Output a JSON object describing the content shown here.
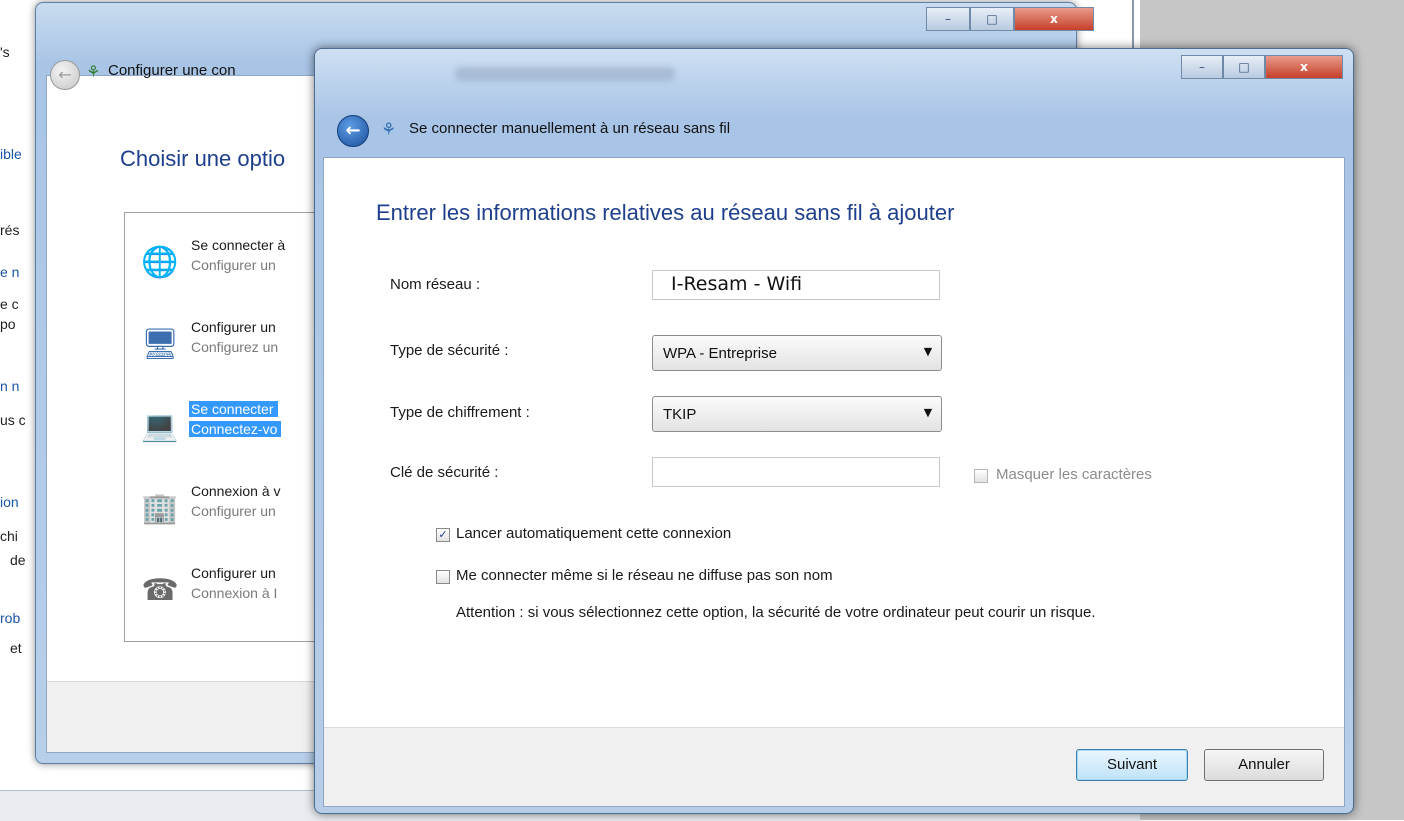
{
  "background": {
    "left_fragments": [
      {
        "text": "'s",
        "link": false
      },
      {
        "text": "ible",
        "link": true
      },
      {
        "text": "rés",
        "link": false
      },
      {
        "text": "e n",
        "link": true
      },
      {
        "text": "e c",
        "link": false
      },
      {
        "text": "po",
        "link": false
      },
      {
        "text": "n n",
        "link": true
      },
      {
        "text": "us c",
        "link": false
      },
      {
        "text": "ion",
        "link": true
      },
      {
        "text": "chi",
        "link": false
      },
      {
        "text": "de",
        "link": false
      },
      {
        "text": "rob",
        "link": true
      },
      {
        "text": "et",
        "link": false
      }
    ]
  },
  "back_window": {
    "title": "Configurer une con",
    "heading": "Choisir une optio",
    "controls": [
      "–",
      "□",
      "x"
    ],
    "options": [
      {
        "title": "Se connecter à",
        "subtitle": "Configurer un",
        "icon": "globe-network-icon",
        "selected": false
      },
      {
        "title": "Configurer un",
        "subtitle": "Configurez un",
        "icon": "router-network-icon",
        "selected": false
      },
      {
        "title": "Se connecter",
        "subtitle": "Connectez-vo",
        "icon": "computer-wireless-icon",
        "selected": true
      },
      {
        "title": "Connexion à v",
        "subtitle": "Configurer un",
        "icon": "vpn-building-icon",
        "selected": false
      },
      {
        "title": "Configurer un",
        "subtitle": "Connexion à I",
        "icon": "dialup-phone-icon",
        "selected": false
      }
    ]
  },
  "dialog": {
    "title": "Se connecter manuellement à un réseau sans fil",
    "controls": [
      "–",
      "□",
      "x"
    ],
    "heading": "Entrer les informations relatives au réseau sans fil à ajouter",
    "fields": {
      "network_name": {
        "label": "Nom réseau :",
        "value": "I-Resam - Wifi"
      },
      "security_type": {
        "label": "Type de sécurité :",
        "value": "WPA - Entreprise"
      },
      "encryption_type": {
        "label": "Type de chiffrement :",
        "value": "TKIP"
      },
      "security_key": {
        "label": "Clé de sécurité :",
        "value": ""
      }
    },
    "hide_characters": {
      "label": "Masquer les caractères",
      "checked": false,
      "enabled": false
    },
    "auto_start": {
      "label": "Lancer automatiquement cette connexion",
      "checked": true
    },
    "connect_hidden": {
      "label": "Me connecter même si le réseau ne diffuse pas son nom",
      "checked": false
    },
    "warning": "Attention : si vous sélectionnez cette option, la sécurité de votre ordinateur peut courir un risque.",
    "buttons": {
      "next": "Suivant",
      "cancel": "Annuler"
    }
  },
  "colors": {
    "heading": "#1e3f8b",
    "selection": "#3399ff",
    "title_bar": "#a8c4e6"
  }
}
